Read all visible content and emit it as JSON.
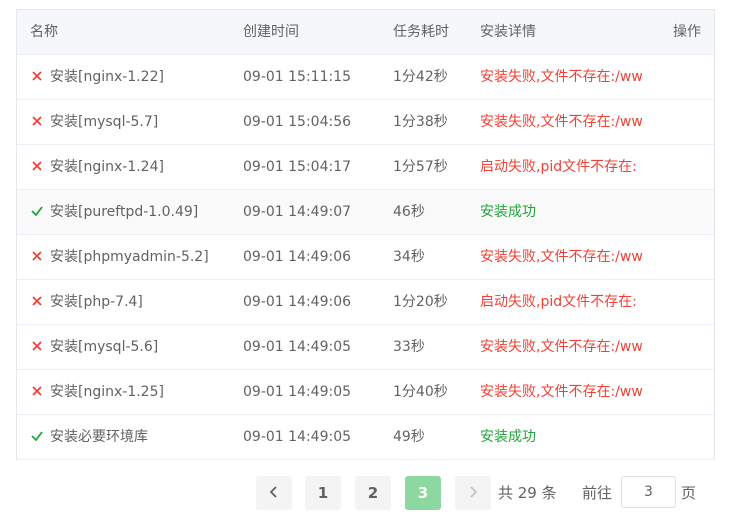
{
  "table": {
    "headers": {
      "name": "名称",
      "created": "创建时间",
      "duration": "任务耗时",
      "detail": "安装详情",
      "action": "操作"
    },
    "rows": [
      {
        "status": "fail",
        "name": "安装[nginx-1.22]",
        "created": "09-01 15:11:15",
        "duration": "1分42秒",
        "detail": "安装失败,文件不存在:/ww"
      },
      {
        "status": "fail",
        "name": "安装[mysql-5.7]",
        "created": "09-01 15:04:56",
        "duration": "1分38秒",
        "detail": "安装失败,文件不存在:/ww"
      },
      {
        "status": "fail",
        "name": "安装[nginx-1.24]",
        "created": "09-01 15:04:17",
        "duration": "1分57秒",
        "detail": "启动失败,pid文件不存在:"
      },
      {
        "status": "success",
        "name": "安装[pureftpd-1.0.49]",
        "created": "09-01 14:49:07",
        "duration": "46秒",
        "detail": "安装成功"
      },
      {
        "status": "fail",
        "name": "安装[phpmyadmin-5.2]",
        "created": "09-01 14:49:06",
        "duration": "34秒",
        "detail": "安装失败,文件不存在:/ww"
      },
      {
        "status": "fail",
        "name": "安装[php-7.4]",
        "created": "09-01 14:49:06",
        "duration": "1分20秒",
        "detail": "启动失败,pid文件不存在:"
      },
      {
        "status": "fail",
        "name": "安装[mysql-5.6]",
        "created": "09-01 14:49:05",
        "duration": "33秒",
        "detail": "安装失败,文件不存在:/ww"
      },
      {
        "status": "fail",
        "name": "安装[nginx-1.25]",
        "created": "09-01 14:49:05",
        "duration": "1分40秒",
        "detail": "安装失败,文件不存在:/ww"
      },
      {
        "status": "success",
        "name": "安装必要环境库",
        "created": "09-01 14:49:05",
        "duration": "49秒",
        "detail": "安装成功"
      }
    ]
  },
  "pagination": {
    "prev_icon": "chevron-left-icon",
    "pages": [
      "1",
      "2",
      "3"
    ],
    "current_page": "3",
    "next_icon": "chevron-right-icon",
    "total_text": "共 29 条",
    "goto_prefix": "前往",
    "goto_value": "3",
    "goto_suffix": "页"
  },
  "colors": {
    "fail": "#f04134",
    "success": "#20a53a",
    "active_page": "#8dd7a0"
  }
}
